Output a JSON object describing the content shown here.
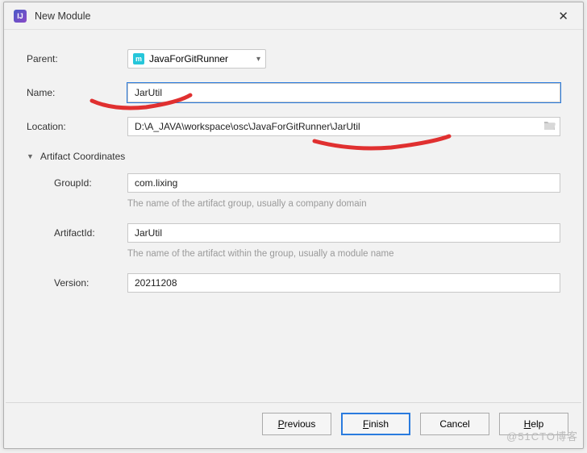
{
  "window": {
    "title": "New Module"
  },
  "fields": {
    "parent": {
      "label": "Parent:",
      "value": "JavaForGitRunner"
    },
    "name": {
      "label": "Name:",
      "value": "JarUtil"
    },
    "location": {
      "label": "Location:",
      "value": "D:\\A_JAVA\\workspace\\osc\\JavaForGitRunner\\JarUtil"
    }
  },
  "artifact": {
    "header": "Artifact Coordinates",
    "groupId": {
      "label": "GroupId:",
      "value": "com.lixing",
      "hint": "The name of the artifact group, usually a company domain"
    },
    "artifactId": {
      "label": "ArtifactId:",
      "value": "JarUtil",
      "hint": "The name of the artifact within the group, usually a module name"
    },
    "version": {
      "label": "Version:",
      "value": "20211208"
    }
  },
  "buttons": {
    "previous": "Previous",
    "finish": "Finish",
    "cancel": "Cancel",
    "help": "Help"
  },
  "watermark": "@51CTO博客"
}
